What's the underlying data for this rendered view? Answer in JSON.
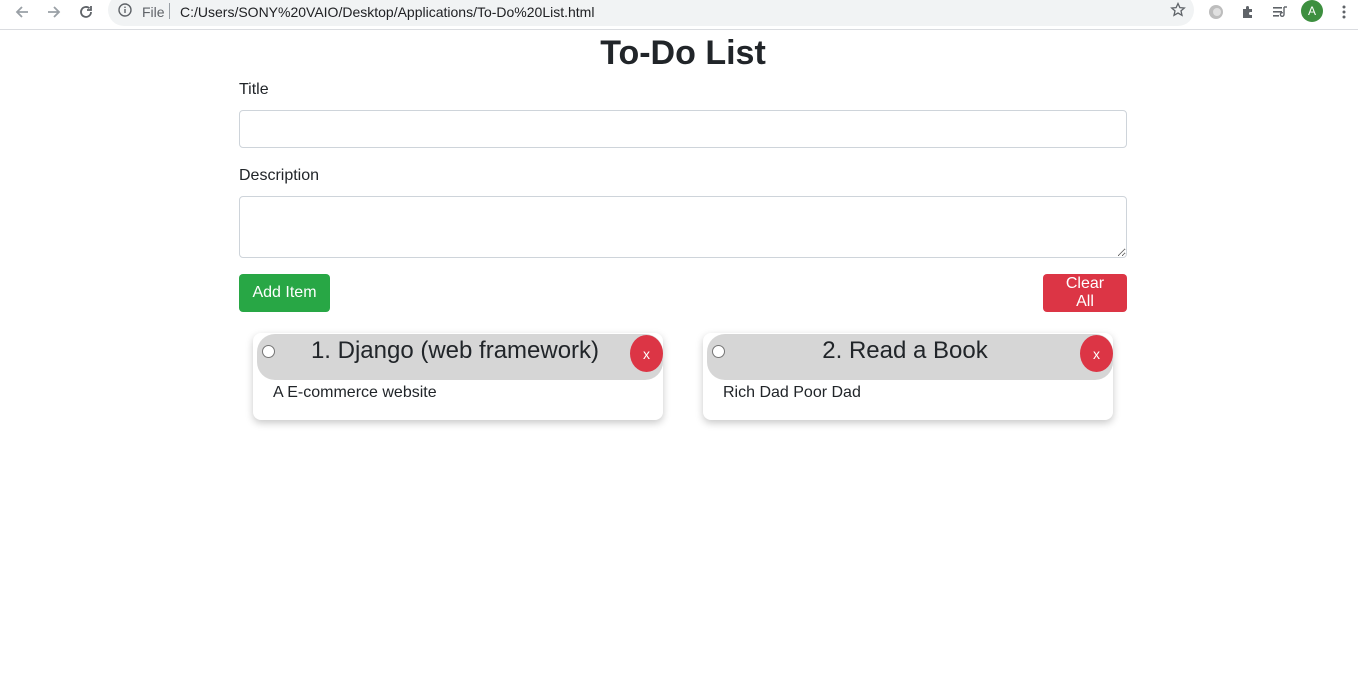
{
  "browser": {
    "file_label": "File",
    "url": "C:/Users/SONY%20VAIO/Desktop/Applications/To-Do%20List.html",
    "avatar_letter": "A"
  },
  "page": {
    "title": "To-Do List"
  },
  "form": {
    "title_label": "Title",
    "title_value": "",
    "description_label": "Description",
    "description_value": "",
    "add_button": "Add Item",
    "clear_button": "Clear All"
  },
  "items": [
    {
      "title": "1. Django (web framework)",
      "description": "A E-commerce website",
      "delete_label": "x"
    },
    {
      "title": "2. Read a Book",
      "description": "Rich Dad Poor Dad",
      "delete_label": "x"
    }
  ],
  "colors": {
    "add": "#28a745",
    "clear": "#dc3545",
    "card_header": "#d6d6d6"
  }
}
